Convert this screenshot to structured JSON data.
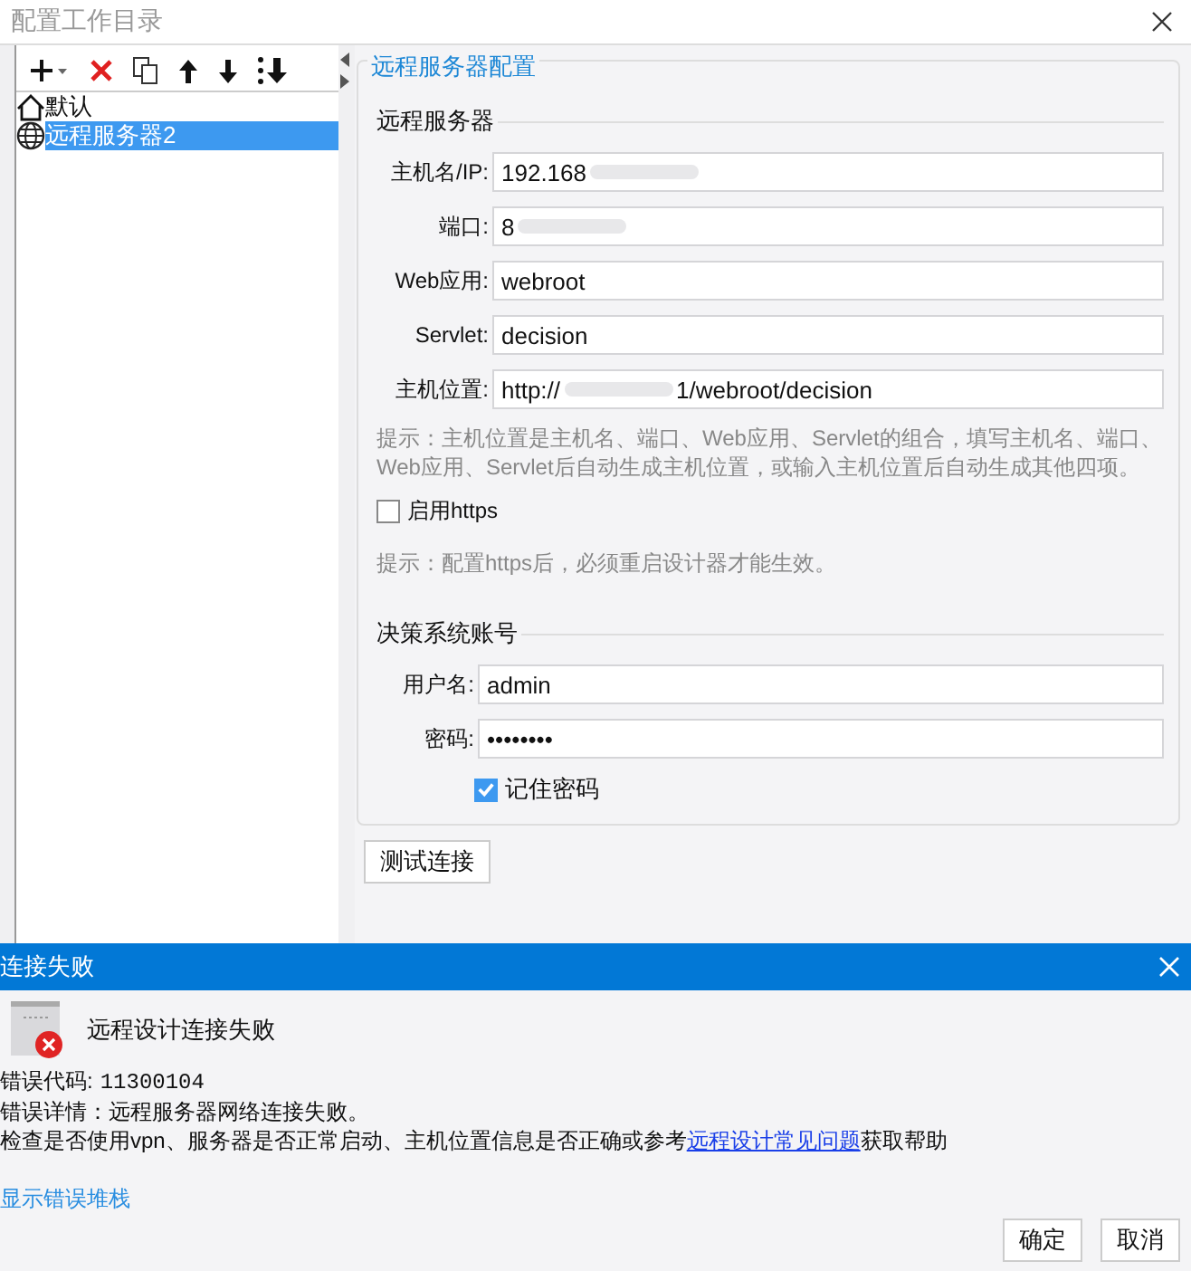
{
  "window": {
    "title": "配置工作目录"
  },
  "tree": [
    {
      "label": "默认",
      "kind": "home",
      "selected": false
    },
    {
      "label": "远程服务器2",
      "kind": "globe",
      "selected": true
    }
  ],
  "config": {
    "title": "远程服务器配置",
    "server_section": "远程服务器",
    "fields": [
      {
        "label": "主机名/IP:",
        "value": "192.168",
        "redacted": true
      },
      {
        "label": "端口:",
        "value": "8",
        "redacted": true
      },
      {
        "label": "Web应用:",
        "value": "webroot",
        "redacted": false
      },
      {
        "label": "Servlet:",
        "value": "decision",
        "redacted": false
      },
      {
        "label": "主机位置:",
        "value": "http://",
        "value_tail": "1/webroot/decision",
        "redacted": true
      }
    ],
    "hint": "提示：主机位置是主机名、端口、Web应用、Servlet的组合，填写主机名、端口、Web应用、Servlet后自动生成主机位置，或输入主机位置后自动生成其他四项。",
    "https": {
      "label": "启用https",
      "checked": false
    },
    "https_hint": "提示：配置https后，必须重启设计器才能生效。",
    "account_section": "决策系统账号",
    "account_fields": [
      {
        "label": "用户名:",
        "value": "admin"
      },
      {
        "label": "密码:",
        "value": "••••••••"
      }
    ],
    "remember": {
      "label": "记住密码",
      "checked": true
    },
    "test_button": "测试连接"
  },
  "dialog": {
    "title": "连接失败",
    "heading": "远程设计连接失败",
    "code_label": "错误代码:",
    "code": "11300104",
    "detail": "错误详情：远程服务器网络连接失败。",
    "check_before": "检查是否使用vpn、服务器是否正常启动、主机位置信息是否正确或参考",
    "check_link": "远程设计常见问题",
    "check_after": "获取帮助",
    "stack_link": "显示错误堆栈",
    "buttons": [
      "确定",
      "取消"
    ]
  }
}
